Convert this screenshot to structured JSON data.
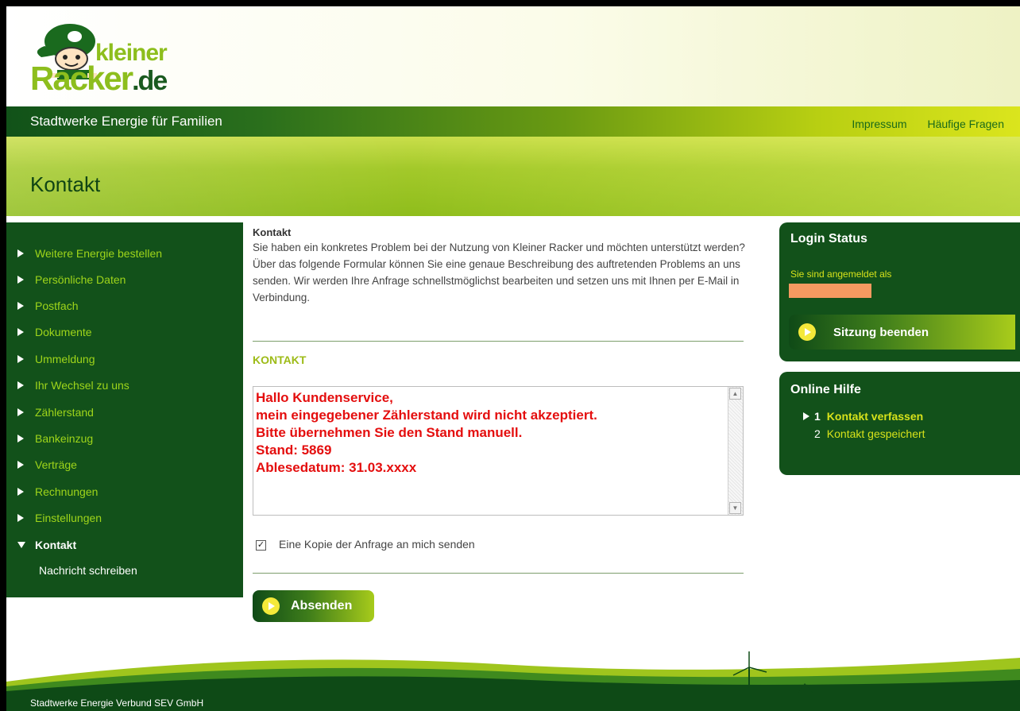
{
  "header": {
    "logo_top": "kleiner",
    "logo_bottom": "Racker",
    "logo_suffix": ".de",
    "tagline": "Stadtwerke Energie für Familien",
    "links": [
      "Impressum",
      "Häufige Fragen"
    ]
  },
  "page_title": "Kontakt",
  "nav": {
    "items": [
      {
        "label": "Weitere Energie bestellen"
      },
      {
        "label": "Persönliche Daten"
      },
      {
        "label": "Postfach"
      },
      {
        "label": "Dokumente"
      },
      {
        "label": "Ummeldung"
      },
      {
        "label": "Ihr Wechsel zu uns"
      },
      {
        "label": "Zählerstand"
      },
      {
        "label": "Bankeinzug"
      },
      {
        "label": "Verträge"
      },
      {
        "label": "Rechnungen"
      },
      {
        "label": "Einstellungen"
      },
      {
        "label": "Kontakt"
      }
    ],
    "sub_item": "Nachricht schreiben"
  },
  "main": {
    "intro_heading": "Kontakt",
    "intro_text": "Sie haben ein konkretes Problem bei der Nutzung von Kleiner Racker und möchten unterstützt werden? Über das folgende Formular können Sie eine genaue Beschreibung des auftretenden Problems an uns senden. Wir werden Ihre Anfrage schnellstmöglichst bearbeiten und setzen uns mit Ihnen per E-Mail in Verbindung.",
    "form_label": "KONTAKT",
    "message": "Hallo Kundenservice,\nmein eingegebener Zählerstand wird nicht akzeptiert.\nBitte übernehmen Sie den Stand manuell.\nStand: 5869\nAblesedatum: 31.03.xxxx",
    "copy_label": "Eine Kopie der Anfrage an mich senden",
    "copy_checked": true,
    "send_label": "Absenden"
  },
  "login": {
    "title": "Login Status",
    "text": "Sie sind angemeldet als",
    "logout_label": "Sitzung beenden"
  },
  "help": {
    "title": "Online Hilfe",
    "steps": [
      {
        "num": "1",
        "label": "Kontakt verfassen"
      },
      {
        "num": "2",
        "label": "Kontakt gespeichert"
      }
    ]
  },
  "footer": {
    "text": "Stadtwerke Energie Verbund SEV GmbH"
  },
  "colors": {
    "dark_green": "#12511a",
    "lime": "#9fd51a",
    "message_red": "#e40e0e"
  }
}
